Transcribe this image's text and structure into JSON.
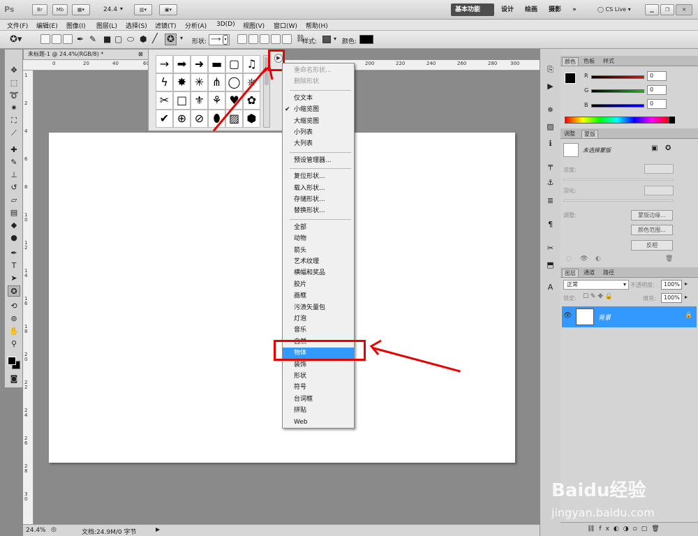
{
  "app": {
    "logo": "Ps",
    "zoom": "24.4",
    "workspaces": [
      "基本功能",
      "设计",
      "绘画",
      "摄影"
    ],
    "more": "»",
    "cslive": "CS Live"
  },
  "menu": [
    "文件(F)",
    "编辑(E)",
    "图像(I)",
    "图层(L)",
    "选择(S)",
    "滤镜(T)",
    "分析(A)",
    "3D(D)",
    "视图(V)",
    "窗口(W)",
    "帮助(H)"
  ],
  "options": {
    "shape_label": "形状:",
    "style_label": "样式:",
    "color_label": "颜色:",
    "color": "#000000"
  },
  "document": {
    "tab_title": "未标题-1 @ 24.4%(RGB/8) *",
    "close": "⊠",
    "zoom_status": "24.4%",
    "doc_status": "文档:24.9M/0 字节"
  },
  "ruler": {
    "top": [
      "0",
      "20",
      "40",
      "60",
      "200",
      "220",
      "240",
      "260",
      "280",
      "300"
    ],
    "left": [
      "1",
      "2",
      "4",
      "6",
      "8",
      "1 0",
      "1 2",
      "1 4",
      "1 6",
      "1 8",
      "2 0",
      "2 2",
      "2 4",
      "2 6",
      "2 8",
      "3 0"
    ]
  },
  "shapes": [
    "→",
    "➡",
    "➜",
    "▬",
    "▢",
    "♫",
    "ϟ",
    "✸",
    "✳",
    "⋔",
    "◯",
    "⎈",
    "✂",
    "□",
    "⚜",
    "⚘",
    "♥",
    "✿",
    "✔",
    "⊕",
    "⊘",
    "⬮",
    "▨",
    "⬢"
  ],
  "flyout_menu": [
    {
      "label": "重命名形状...",
      "disabled": true
    },
    {
      "label": "删除形状",
      "disabled": true
    },
    {
      "sep": true
    },
    {
      "label": "仅文本"
    },
    {
      "label": "小缩览图",
      "checked": true
    },
    {
      "label": "大缩览图"
    },
    {
      "label": "小列表"
    },
    {
      "label": "大列表"
    },
    {
      "sep": true
    },
    {
      "label": "预设管理器..."
    },
    {
      "sep": true
    },
    {
      "label": "复位形状..."
    },
    {
      "label": "载入形状..."
    },
    {
      "label": "存储形状..."
    },
    {
      "label": "替换形状..."
    },
    {
      "sep": true
    },
    {
      "label": "全部"
    },
    {
      "label": "动物"
    },
    {
      "label": "箭头"
    },
    {
      "label": "艺术纹理"
    },
    {
      "label": "横幅和奖品"
    },
    {
      "label": "胶片"
    },
    {
      "label": "画框"
    },
    {
      "label": "污渍矢量包"
    },
    {
      "label": "灯泡"
    },
    {
      "label": "音乐"
    },
    {
      "label": "自然"
    },
    {
      "label": "物体",
      "selected": true
    },
    {
      "label": "装饰"
    },
    {
      "label": "形状"
    },
    {
      "label": "符号"
    },
    {
      "label": "台词框"
    },
    {
      "label": "拼贴"
    },
    {
      "label": "Web"
    }
  ],
  "color_panel": {
    "tabs": [
      "颜色",
      "色板",
      "样式"
    ],
    "r": "0",
    "g": "0",
    "b": "0",
    "r_label": "R",
    "g_label": "G",
    "b_label": "B"
  },
  "adjust_panel": {
    "tabs": [
      "调整",
      "蒙版"
    ],
    "title": "未选择蒙版",
    "density": "浓度:",
    "feather": "羽化:",
    "refine": "调整:",
    "btn_edge": "蒙版边缘...",
    "btn_range": "颜色范围...",
    "btn_invert": "反相"
  },
  "layers_panel": {
    "tabs": [
      "图层",
      "通道",
      "路径"
    ],
    "blend": "正常",
    "opacity_label": "不透明度:",
    "opacity": "100%",
    "lock_label": "锁定:",
    "fill_label": "填充:",
    "fill": "100%",
    "layer_name": "背景"
  },
  "watermark": {
    "brand": "Baidu经验",
    "url": "jingyan.baidu.com"
  }
}
